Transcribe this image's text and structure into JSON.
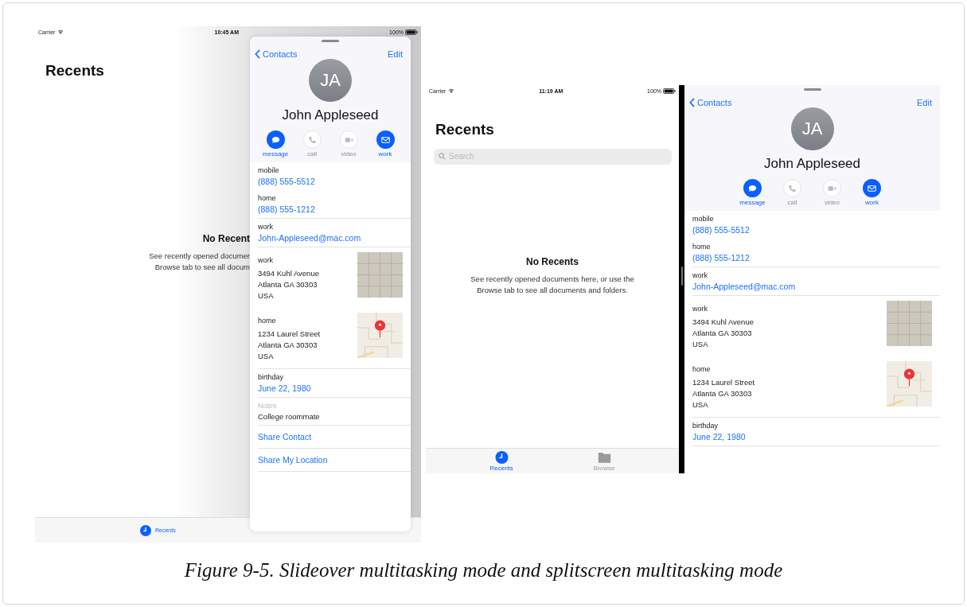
{
  "screens": [
    {
      "kind": "slideover",
      "status_bar": {
        "carrier": "Carrier",
        "time": "10:45 AM",
        "battery": "100%"
      },
      "app": {
        "title": "Recents",
        "empty_title": "No Recent",
        "empty_message": [
          "See recently opened documer",
          "Browse tab to see all docum"
        ],
        "tabs": [
          {
            "label": "Recents",
            "selected": true,
            "kind": "clock"
          }
        ]
      },
      "contact_panel": {
        "back": "Contacts",
        "edit": "Edit",
        "initials": "JA",
        "name": "John Appleseed",
        "actions": [
          {
            "label": "message",
            "kind": "message",
            "enabled": true
          },
          {
            "label": "call",
            "kind": "call",
            "enabled": false
          },
          {
            "label": "video",
            "kind": "video",
            "enabled": false
          },
          {
            "label": "work",
            "kind": "mail",
            "enabled": true
          }
        ],
        "fields": [
          {
            "kind": "value",
            "label": "mobile",
            "value": "(888) 555-5512",
            "divider": false
          },
          {
            "kind": "value",
            "label": "home",
            "value": "(888) 555-1212",
            "divider": true
          },
          {
            "kind": "value",
            "label": "work",
            "value": "John-Appleseed@mac.com",
            "divider": true
          },
          {
            "kind": "address",
            "label": "work",
            "lines": [
              "3494 Kuhl Avenue",
              "Atlanta GA 30303",
              "USA"
            ],
            "map_loaded": false,
            "divider": false
          },
          {
            "kind": "address",
            "label": "home",
            "lines": [
              "1234 Laurel Street",
              "Atlanta GA 30303",
              "USA"
            ],
            "map_loaded": true,
            "divider": true
          },
          {
            "kind": "value",
            "label": "birthday",
            "value": "June 22, 1980",
            "divider": true
          },
          {
            "kind": "note",
            "label": "Notes",
            "value": "College roommate",
            "divider": true
          },
          {
            "kind": "link",
            "value": "Share Contact",
            "divider": true
          },
          {
            "kind": "link",
            "value": "Share My Location",
            "divider": true
          }
        ]
      }
    },
    {
      "kind": "splitscreen",
      "status_bar": {
        "carrier": "Carrier",
        "time": "11:19 AM",
        "battery": "100%"
      },
      "app": {
        "title": "Recents",
        "search": {
          "placeholder": "Search"
        },
        "empty_title": "No Recents",
        "empty_message": [
          "See recently opened documents here, or use the",
          "Browse tab to see all documents and folders."
        ],
        "tabs": [
          {
            "label": "Recents",
            "selected": true,
            "kind": "clock"
          },
          {
            "label": "Browse",
            "selected": false,
            "kind": "folder"
          }
        ]
      },
      "contact_panel": {
        "back": "Contacts",
        "edit": "Edit",
        "initials": "JA",
        "name": "John Appleseed",
        "actions": [
          {
            "label": "message",
            "kind": "message",
            "enabled": true
          },
          {
            "label": "call",
            "kind": "call",
            "enabled": false
          },
          {
            "label": "video",
            "kind": "video",
            "enabled": false
          },
          {
            "label": "work",
            "kind": "mail",
            "enabled": true
          }
        ],
        "fields": [
          {
            "kind": "value",
            "label": "mobile",
            "value": "(888) 555-5512",
            "divider": false
          },
          {
            "kind": "value",
            "label": "home",
            "value": "(888) 555-1212",
            "divider": true
          },
          {
            "kind": "value",
            "label": "work",
            "value": "John-Appleseed@mac.com",
            "divider": true
          },
          {
            "kind": "address",
            "label": "work",
            "lines": [
              "3494 Kuhl Avenue",
              "Atlanta GA 30303",
              "USA"
            ],
            "map_loaded": false,
            "divider": false
          },
          {
            "kind": "address",
            "label": "home",
            "lines": [
              "1234 Laurel Street",
              "Atlanta GA 30303",
              "USA"
            ],
            "map_loaded": true,
            "divider": true
          },
          {
            "kind": "value",
            "label": "birthday",
            "value": "June 22, 1980",
            "divider": true
          }
        ]
      }
    }
  ],
  "caption": "Figure 9-5. Slideover multitasking mode and splitscreen multitasking mode"
}
